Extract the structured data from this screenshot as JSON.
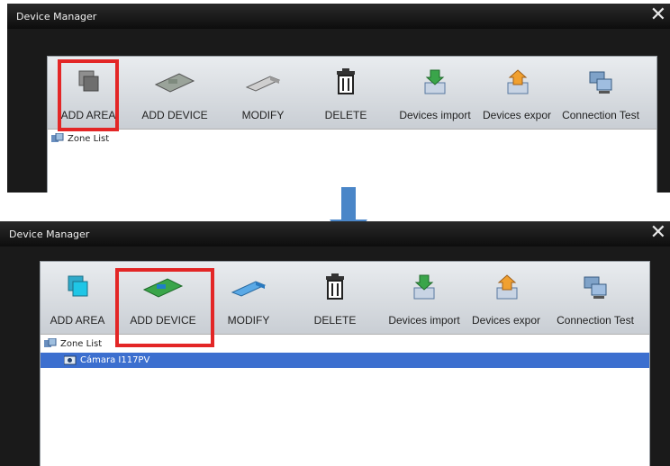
{
  "window_title": "Device Manager",
  "close_glyph": "✕",
  "toolbar": [
    {
      "label": "ADD AREA",
      "icon": "add-area-icon"
    },
    {
      "label": "ADD DEVICE",
      "icon": "add-device-icon"
    },
    {
      "label": "MODIFY",
      "icon": "modify-icon"
    },
    {
      "label": "DELETE",
      "icon": "delete-icon"
    },
    {
      "label": "Devices import",
      "icon": "devices-import-icon"
    },
    {
      "label": "Devices expor",
      "icon": "devices-export-icon"
    },
    {
      "label": "Connection Test",
      "icon": "connection-test-icon"
    }
  ],
  "tree": {
    "root": "Zone List",
    "device": "Cámara I117PV"
  },
  "colors": {
    "highlight": "#e32626",
    "selection": "#3c6fcf",
    "arrow": "#4a86c8"
  }
}
